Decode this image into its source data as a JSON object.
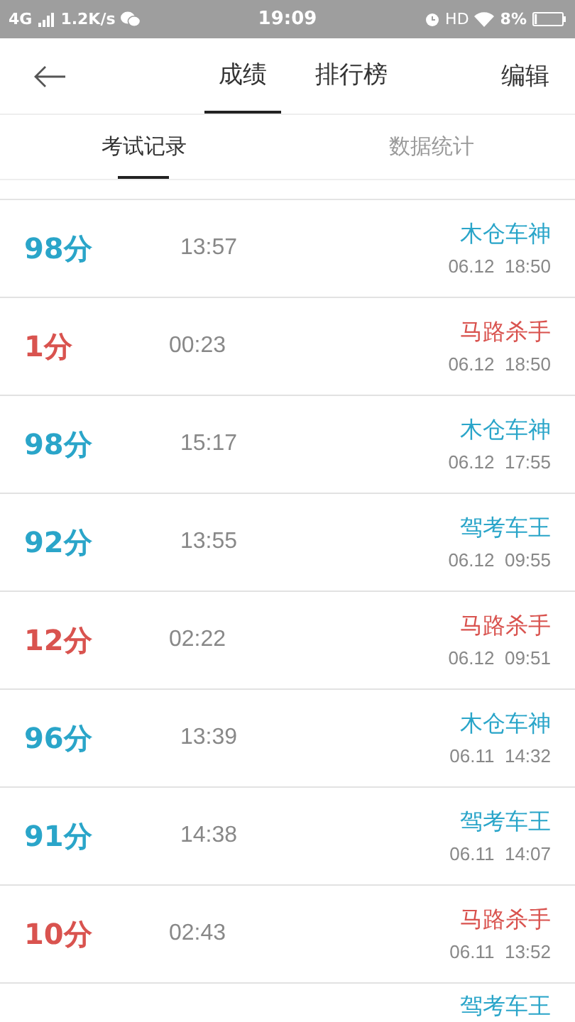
{
  "status_bar": {
    "network": "4G",
    "speed": "1.2K/s",
    "time": "19:09",
    "hd": "HD",
    "battery": "8%"
  },
  "header": {
    "tabs": [
      {
        "label": "成绩",
        "selected": true
      },
      {
        "label": "排行榜",
        "selected": false
      }
    ],
    "action": "编辑"
  },
  "sub_tabs": [
    {
      "label": "考试记录",
      "selected": true
    },
    {
      "label": "数据统计",
      "selected": false
    }
  ],
  "records": [
    {
      "score": "98分",
      "duration": "13:57",
      "title": "木仓车神",
      "date": "06.12  18:50",
      "passed": true
    },
    {
      "score": "1分",
      "duration": "00:23",
      "title": "马路杀手",
      "date": "06.12  18:50",
      "passed": false
    },
    {
      "score": "98分",
      "duration": "15:17",
      "title": "木仓车神",
      "date": "06.12  17:55",
      "passed": true
    },
    {
      "score": "92分",
      "duration": "13:55",
      "title": "驾考车王",
      "date": "06.12  09:55",
      "passed": true
    },
    {
      "score": "12分",
      "duration": "02:22",
      "title": "马路杀手",
      "date": "06.12  09:51",
      "passed": false
    },
    {
      "score": "96分",
      "duration": "13:39",
      "title": "木仓车神",
      "date": "06.11  14:32",
      "passed": true
    },
    {
      "score": "91分",
      "duration": "14:38",
      "title": "驾考车王",
      "date": "06.11  14:07",
      "passed": true
    },
    {
      "score": "10分",
      "duration": "02:43",
      "title": "马路杀手",
      "date": "06.11  13:52",
      "passed": false
    },
    {
      "title": "驾考车王",
      "passed": true
    }
  ]
}
